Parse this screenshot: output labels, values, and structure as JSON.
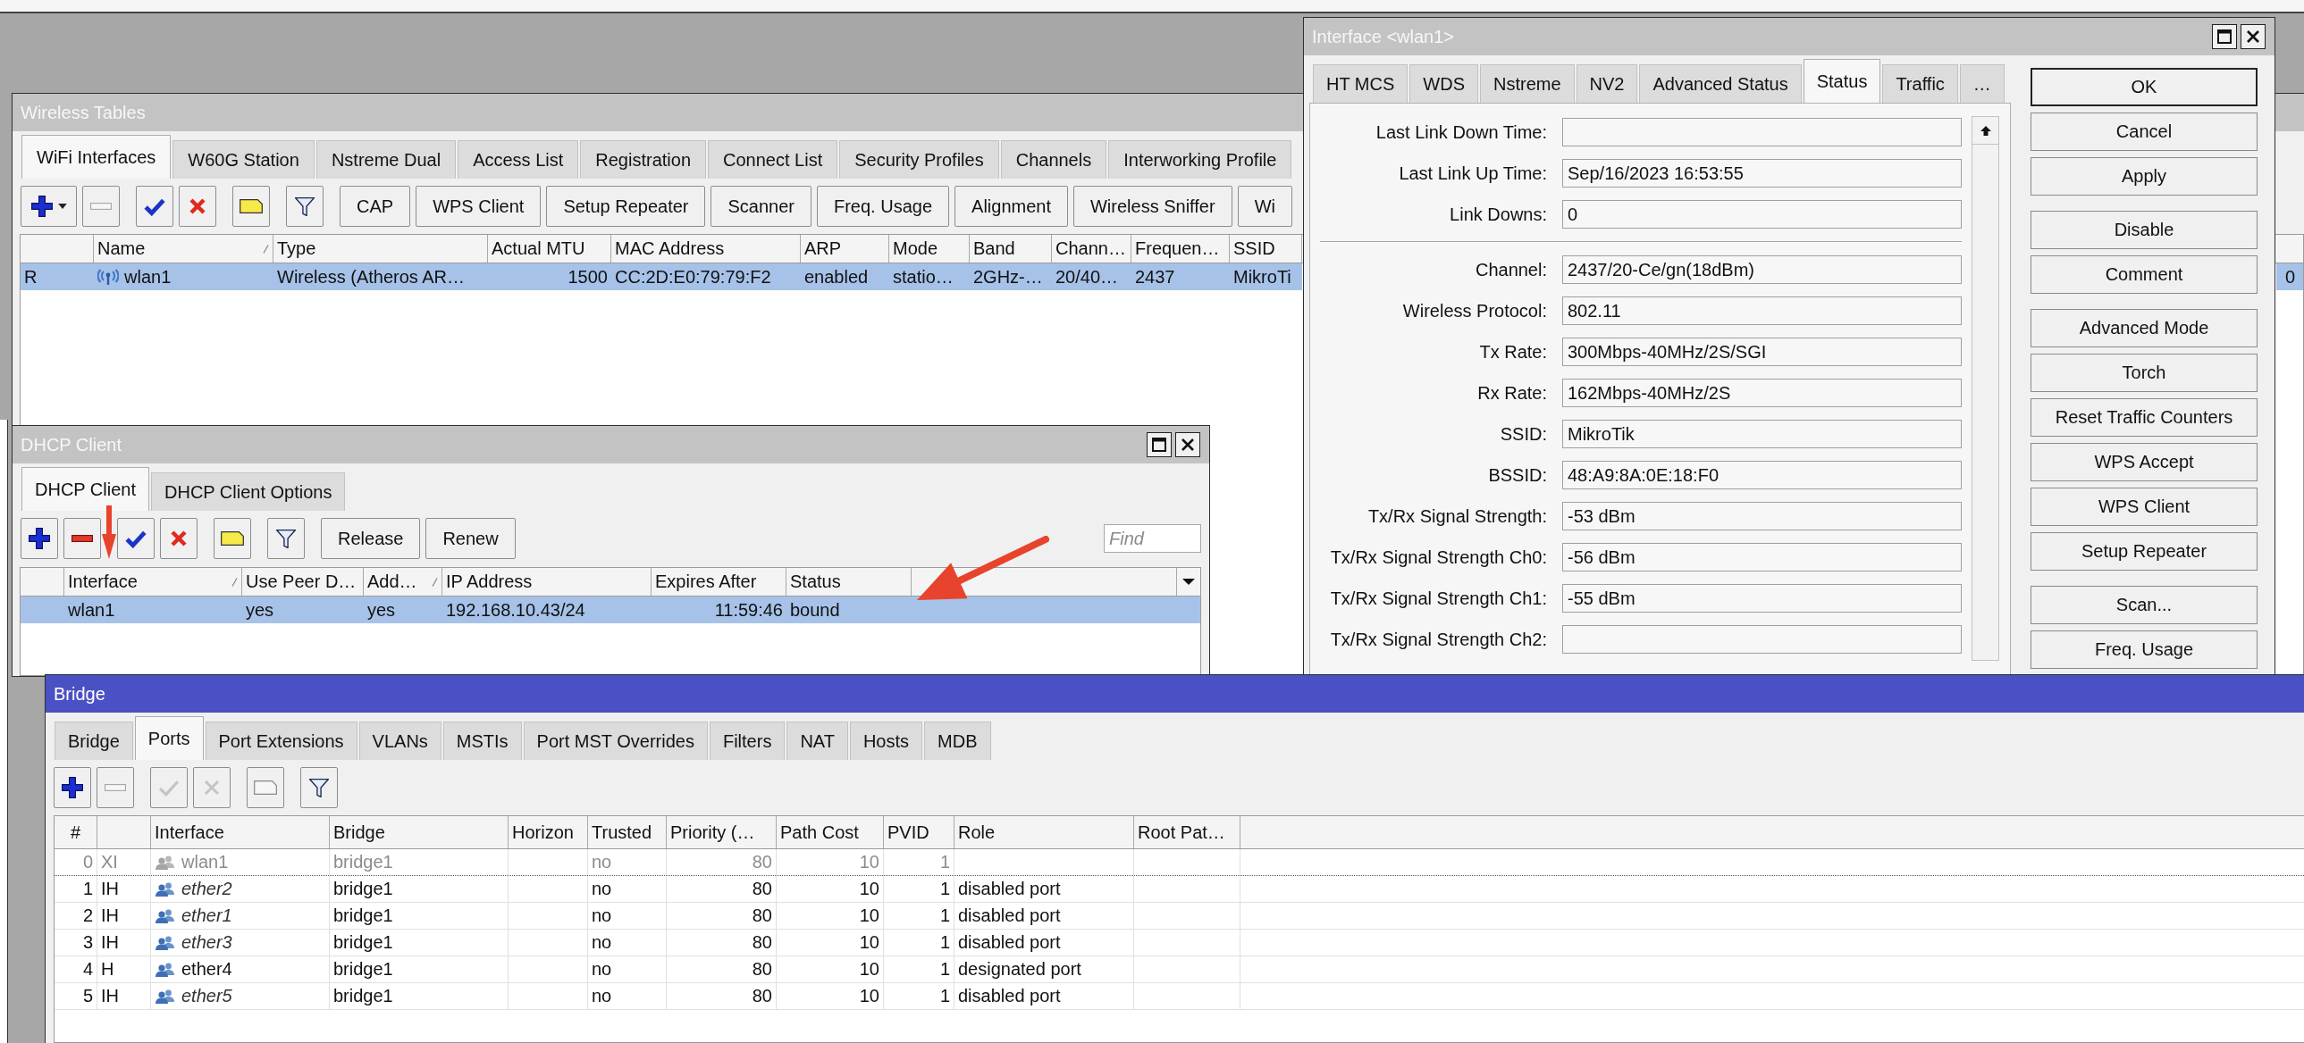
{
  "wireless_tables": {
    "title": "Wireless Tables",
    "active": false,
    "tabs": [
      {
        "label": "WiFi Interfaces",
        "selected": true
      },
      {
        "label": "W60G Station",
        "selected": false
      },
      {
        "label": "Nstreme Dual",
        "selected": false
      },
      {
        "label": "Access List",
        "selected": false
      },
      {
        "label": "Registration",
        "selected": false
      },
      {
        "label": "Connect List",
        "selected": false
      },
      {
        "label": "Security Profiles",
        "selected": false
      },
      {
        "label": "Channels",
        "selected": false
      },
      {
        "label": "Interworking Profile",
        "selected": false
      }
    ],
    "toolbar": [
      {
        "kind": "add_menu",
        "disabled": false
      },
      {
        "kind": "remove",
        "disabled": true
      },
      {
        "kind": "enable",
        "disabled": false
      },
      {
        "kind": "disable",
        "disabled": false
      },
      {
        "kind": "comment",
        "disabled": false
      },
      {
        "kind": "filter",
        "disabled": false
      },
      {
        "kind": "button",
        "label": "CAP",
        "disabled": false
      },
      {
        "kind": "button",
        "label": "WPS Client",
        "disabled": false
      },
      {
        "kind": "button",
        "label": "Setup Repeater",
        "disabled": false
      },
      {
        "kind": "button",
        "label": "Scanner",
        "disabled": false
      },
      {
        "kind": "button",
        "label": "Freq. Usage",
        "disabled": false
      },
      {
        "kind": "button",
        "label": "Alignment",
        "disabled": false
      },
      {
        "kind": "button",
        "label": "Wireless Sniffer",
        "disabled": false
      },
      {
        "kind": "button",
        "label": "Wi",
        "disabled": false
      }
    ],
    "table": {
      "columns": [
        {
          "sorted": false
        },
        {
          "label": "Name",
          "sorted": true
        },
        {
          "label": "Type",
          "sorted": false
        },
        {
          "label": "Actual MTU",
          "sorted": false
        },
        {
          "label": "MAC Address",
          "sorted": false
        },
        {
          "label": "ARP",
          "sorted": false
        },
        {
          "label": "Mode",
          "sorted": false
        },
        {
          "label": "Band",
          "sorted": false
        },
        {
          "label": "Chann…",
          "sorted": false
        },
        {
          "label": "Frequen…",
          "sorted": false
        },
        {
          "label": "SSID",
          "sorted": false
        }
      ],
      "rows": [
        {
          "selected": true,
          "column_1": "R",
          "name": "wlan1",
          "type": "Wireless (Atheros AR…",
          "actual_mtu": "1500",
          "mac_address": "CC:2D:E0:79:79:F2",
          "arp": "enabled",
          "mode": "statio…",
          "band": "2GHz-…",
          "column_9": "20/40…",
          "column_10": "2437",
          "ssid": "MikroTi",
          "column_at_right_edge": "0"
        }
      ]
    }
  },
  "dhcp_client": {
    "title": "DHCP Client",
    "active": false,
    "tabs": [
      {
        "label": "DHCP Client",
        "selected": true
      },
      {
        "label": "DHCP Client Options",
        "selected": false
      }
    ],
    "toolbar": [
      {
        "kind": "add",
        "disabled": false
      },
      {
        "kind": "remove",
        "disabled": false
      },
      {
        "kind": "enable",
        "disabled": false
      },
      {
        "kind": "disable",
        "disabled": false
      },
      {
        "kind": "comment",
        "disabled": false
      },
      {
        "kind": "filter",
        "disabled": false
      },
      {
        "kind": "button",
        "label": "Release",
        "disabled": false
      },
      {
        "kind": "button",
        "label": "Renew",
        "disabled": false
      }
    ],
    "find": {
      "placeholder": "Find"
    },
    "table": {
      "columns": [
        {
          "sorted": false
        },
        {
          "label": "Interface",
          "sorted": true
        },
        {
          "label": "Use Peer D…",
          "sorted": false
        },
        {
          "label": "Add…",
          "sorted": true
        },
        {
          "label": "IP Address",
          "sorted": false
        },
        {
          "label": "Expires After",
          "sorted": false
        },
        {
          "label": "Status",
          "sorted": false
        }
      ],
      "rows": [
        {
          "selected": true,
          "interface": "wlan1",
          "column_3": "yes",
          "column_4": "yes",
          "ip_address": "192.168.10.43/24",
          "expires_after": "11:59:46",
          "status": "bound"
        }
      ]
    }
  },
  "interface_window": {
    "title": "Interface <wlan1>",
    "active": false,
    "tabs": [
      {
        "label": "HT MCS",
        "selected": false
      },
      {
        "label": "WDS",
        "selected": false
      },
      {
        "label": "Nstreme",
        "selected": false
      },
      {
        "label": "NV2",
        "selected": false
      },
      {
        "label": "Advanced Status",
        "selected": false
      },
      {
        "label": "Status",
        "selected": true
      },
      {
        "label": "Traffic",
        "selected": false
      },
      {
        "label": "…",
        "selected": false
      }
    ],
    "fields": [
      {
        "kind": "field",
        "label": "Last Link Down Time:"
      },
      {
        "kind": "field",
        "label": "Last Link Up Time:",
        "value": "Sep/16/2023 16:53:55"
      },
      {
        "kind": "field",
        "label": "Link Downs:",
        "value": "0"
      },
      {
        "kind": "separator"
      },
      {
        "kind": "field",
        "label": "Channel:",
        "value": "2437/20-Ce/gn(18dBm)"
      },
      {
        "kind": "field",
        "label": "Wireless Protocol:",
        "value": "802.11"
      },
      {
        "kind": "field",
        "label": "Tx Rate:",
        "value": "300Mbps-40MHz/2S/SGI"
      },
      {
        "kind": "field",
        "label": "Rx Rate:",
        "value": "162Mbps-40MHz/2S"
      },
      {
        "kind": "field",
        "label": "SSID:",
        "value": "MikroTik"
      },
      {
        "kind": "field",
        "label": "BSSID:",
        "value": "48:A9:8A:0E:18:F0"
      },
      {
        "kind": "field",
        "label": "Tx/Rx Signal Strength:",
        "value": "-53 dBm"
      },
      {
        "kind": "field",
        "label": "Tx/Rx Signal Strength Ch0:",
        "value": "-56 dBm"
      },
      {
        "kind": "field",
        "label": "Tx/Rx Signal Strength Ch1:",
        "value": "-55 dBm"
      },
      {
        "kind": "field",
        "label": "Tx/Rx Signal Strength Ch2:"
      }
    ],
    "button_groups": [
      [
        {
          "label": "OK",
          "default": true
        },
        {
          "label": "Cancel",
          "default": false
        },
        {
          "label": "Apply",
          "default": false
        }
      ],
      [
        {
          "label": "Disable",
          "default": false
        },
        {
          "label": "Comment",
          "default": false
        }
      ],
      [
        {
          "label": "Advanced Mode",
          "default": false
        },
        {
          "label": "Torch",
          "default": false
        },
        {
          "label": "Reset Traffic Counters",
          "default": false
        },
        {
          "label": "WPS Accept",
          "default": false
        },
        {
          "label": "WPS Client",
          "default": false
        },
        {
          "label": "Setup Repeater",
          "default": false
        }
      ],
      [
        {
          "label": "Scan...",
          "default": false
        },
        {
          "label": "Freq. Usage",
          "default": false
        }
      ]
    ]
  },
  "bridge": {
    "title": "Bridge",
    "active": true,
    "tabs": [
      {
        "label": "Bridge",
        "selected": false
      },
      {
        "label": "Ports",
        "selected": true
      },
      {
        "label": "Port Extensions",
        "selected": false
      },
      {
        "label": "VLANs",
        "selected": false
      },
      {
        "label": "MSTIs",
        "selected": false
      },
      {
        "label": "Port MST Overrides",
        "selected": false
      },
      {
        "label": "Filters",
        "selected": false
      },
      {
        "label": "NAT",
        "selected": false
      },
      {
        "label": "Hosts",
        "selected": false
      },
      {
        "label": "MDB",
        "selected": false
      }
    ],
    "toolbar": [
      {
        "kind": "add",
        "disabled": false
      },
      {
        "kind": "remove",
        "disabled": true
      },
      {
        "kind": "enable",
        "disabled": true
      },
      {
        "kind": "disable",
        "disabled": true
      },
      {
        "kind": "comment",
        "disabled": true
      },
      {
        "kind": "filter",
        "disabled": false
      }
    ],
    "table": {
      "columns": [
        {
          "label": "#",
          "sorted": false
        },
        {
          "sorted": false
        },
        {
          "label": "Interface",
          "sorted": false
        },
        {
          "label": "Bridge",
          "sorted": false
        },
        {
          "label": "Horizon",
          "sorted": false
        },
        {
          "label": "Trusted",
          "sorted": false
        },
        {
          "label": "Priority (…",
          "sorted": false
        },
        {
          "label": "Path Cost",
          "sorted": false
        },
        {
          "label": "PVID",
          "sorted": false
        },
        {
          "label": "Role",
          "sorted": false
        },
        {
          "label": "Root Pat…",
          "sorted": false
        }
      ],
      "rows": [
        {
          "selected": false,
          "disabled": true,
          "inactive": false,
          "focused": true,
          "number": "0",
          "column_2": "XI",
          "interface": "wlan1",
          "bridge": "bridge1",
          "trusted": "no",
          "column_7": "80",
          "path_cost": "10",
          "pvid": "1"
        },
        {
          "selected": false,
          "disabled": false,
          "inactive": true,
          "focused": false,
          "number": "1",
          "column_2": "IH",
          "interface": "ether2",
          "bridge": "bridge1",
          "trusted": "no",
          "column_7": "80",
          "path_cost": "10",
          "pvid": "1",
          "role": "disabled port"
        },
        {
          "selected": false,
          "disabled": false,
          "inactive": true,
          "focused": false,
          "number": "2",
          "column_2": "IH",
          "interface": "ether1",
          "bridge": "bridge1",
          "trusted": "no",
          "column_7": "80",
          "path_cost": "10",
          "pvid": "1",
          "role": "disabled port"
        },
        {
          "selected": false,
          "disabled": false,
          "inactive": true,
          "focused": false,
          "number": "3",
          "column_2": "IH",
          "interface": "ether3",
          "bridge": "bridge1",
          "trusted": "no",
          "column_7": "80",
          "path_cost": "10",
          "pvid": "1",
          "role": "disabled port"
        },
        {
          "selected": false,
          "disabled": false,
          "inactive": false,
          "focused": false,
          "number": "4",
          "column_2": "H",
          "interface": "ether4",
          "bridge": "bridge1",
          "trusted": "no",
          "column_7": "80",
          "path_cost": "10",
          "pvid": "1",
          "role": "designated port"
        },
        {
          "selected": false,
          "disabled": false,
          "inactive": true,
          "focused": false,
          "number": "5",
          "column_2": "IH",
          "interface": "ether5",
          "bridge": "bridge1",
          "trusted": "no",
          "column_7": "80",
          "path_cost": "10",
          "pvid": "1",
          "role": "disabled port"
        }
      ]
    }
  }
}
